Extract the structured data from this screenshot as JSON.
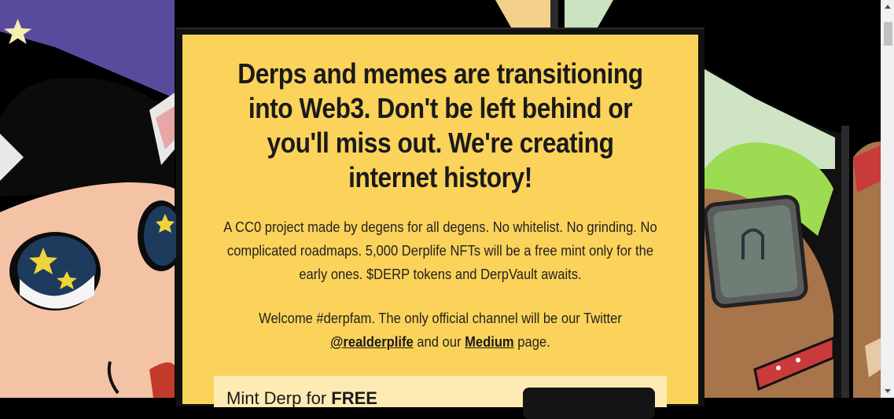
{
  "hero": {
    "headline": "Derps and memes are transitioning into Web3. Don't be left behind or you'll miss out. We're creating internet history!",
    "description": "A CC0 project made by degens for all degens. No whitelist. No grinding. No complicated roadmaps. 5,000 Derplife NFTs will be a free mint only for the early ones. $DERP tokens and DerpVault awaits.",
    "welcome_prefix": "Welcome #derpfam. The only official channel will be our Twitter",
    "twitter_link": "@realderplife",
    "welcome_middle": "and our",
    "medium_link": "Medium",
    "welcome_suffix": "page."
  },
  "mint": {
    "label_prefix": "Mint Derp for",
    "label_price": "FREE"
  },
  "colors": {
    "modal_bg": "#fcd35a",
    "mint_box_bg": "#feebb3",
    "text": "#1a1a1a"
  }
}
